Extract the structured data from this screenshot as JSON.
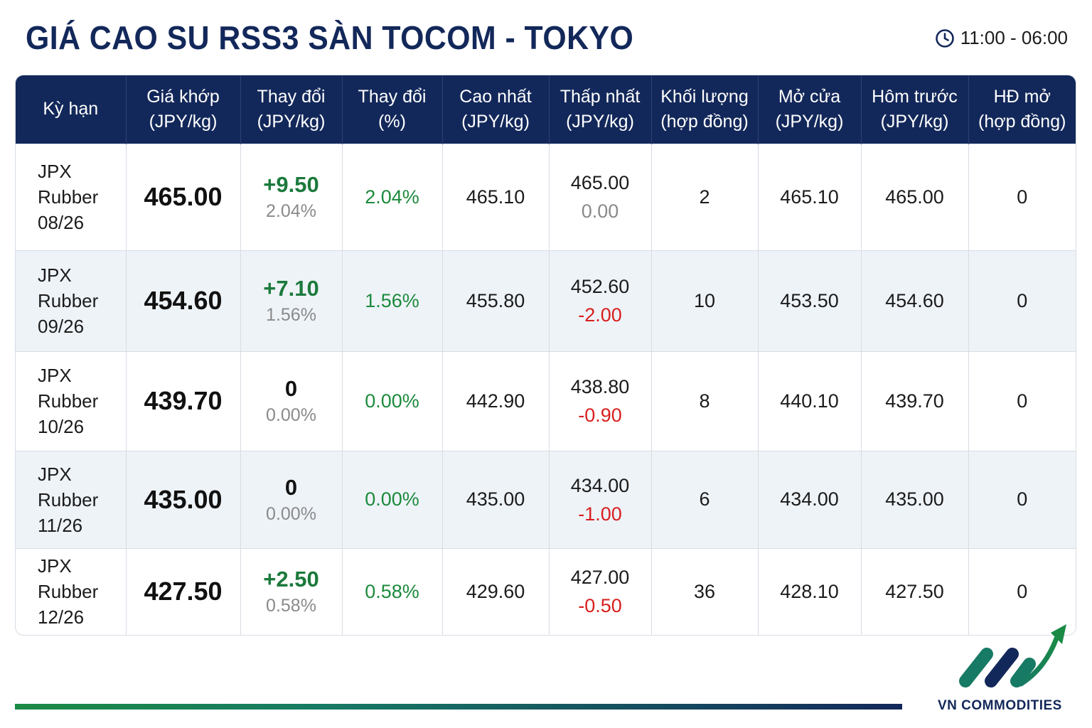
{
  "title": "GIÁ CAO SU RSS3 SÀN TOCOM - TOKYO",
  "time_range": "11:00 - 06:00",
  "brand": "VN COMMODITIES",
  "colors": {
    "navy": "#13285a",
    "green": "#1c8a3c",
    "red": "#d81e1e",
    "row_alt": "#eef3f8"
  },
  "headers": [
    {
      "l1": "Kỳ hạn",
      "l2": ""
    },
    {
      "l1": "Giá khớp",
      "l2": "(JPY/kg)"
    },
    {
      "l1": "Thay đổi",
      "l2": "(JPY/kg)"
    },
    {
      "l1": "Thay đổi",
      "l2": "(%)"
    },
    {
      "l1": "Cao nhất",
      "l2": "(JPY/kg)"
    },
    {
      "l1": "Thấp nhất",
      "l2": "(JPY/kg)"
    },
    {
      "l1": "Khối lượng",
      "l2": "(hợp đồng)"
    },
    {
      "l1": "Mở cửa",
      "l2": "(JPY/kg)"
    },
    {
      "l1": "Hôm trước",
      "l2": "(JPY/kg)"
    },
    {
      "l1": "HĐ mở",
      "l2": "(hợp đồng)"
    }
  ],
  "rows": [
    {
      "term": [
        "JPX",
        "Rubber",
        "08/26"
      ],
      "price": "465.00",
      "change": "+9.50",
      "change_pct_sub": "2.04%",
      "change_pct": "2.04%",
      "high": "465.10",
      "low": "465.00",
      "low_change": "0.00",
      "volume": "2",
      "open": "465.10",
      "prev": "465.00",
      "oi": "0"
    },
    {
      "term": [
        "JPX",
        "Rubber",
        "09/26"
      ],
      "price": "454.60",
      "change": "+7.10",
      "change_pct_sub": "1.56%",
      "change_pct": "1.56%",
      "high": "455.80",
      "low": "452.60",
      "low_change": "-2.00",
      "volume": "10",
      "open": "453.50",
      "prev": "454.60",
      "oi": "0"
    },
    {
      "term": [
        "JPX",
        "Rubber",
        "10/26"
      ],
      "price": "439.70",
      "change": "0",
      "change_pct_sub": "0.00%",
      "change_pct": "0.00%",
      "high": "442.90",
      "low": "438.80",
      "low_change": "-0.90",
      "volume": "8",
      "open": "440.10",
      "prev": "439.70",
      "oi": "0"
    },
    {
      "term": [
        "JPX",
        "Rubber",
        "11/26"
      ],
      "price": "435.00",
      "change": "0",
      "change_pct_sub": "0.00%",
      "change_pct": "0.00%",
      "high": "435.00",
      "low": "434.00",
      "low_change": "-1.00",
      "volume": "6",
      "open": "434.00",
      "prev": "435.00",
      "oi": "0"
    },
    {
      "term": [
        "JPX",
        "Rubber",
        "12/26"
      ],
      "price": "427.50",
      "change": "+2.50",
      "change_pct_sub": "0.58%",
      "change_pct": "0.58%",
      "high": "429.60",
      "low": "427.00",
      "low_change": "-0.50",
      "volume": "36",
      "open": "428.10",
      "prev": "427.50",
      "oi": "0"
    }
  ]
}
